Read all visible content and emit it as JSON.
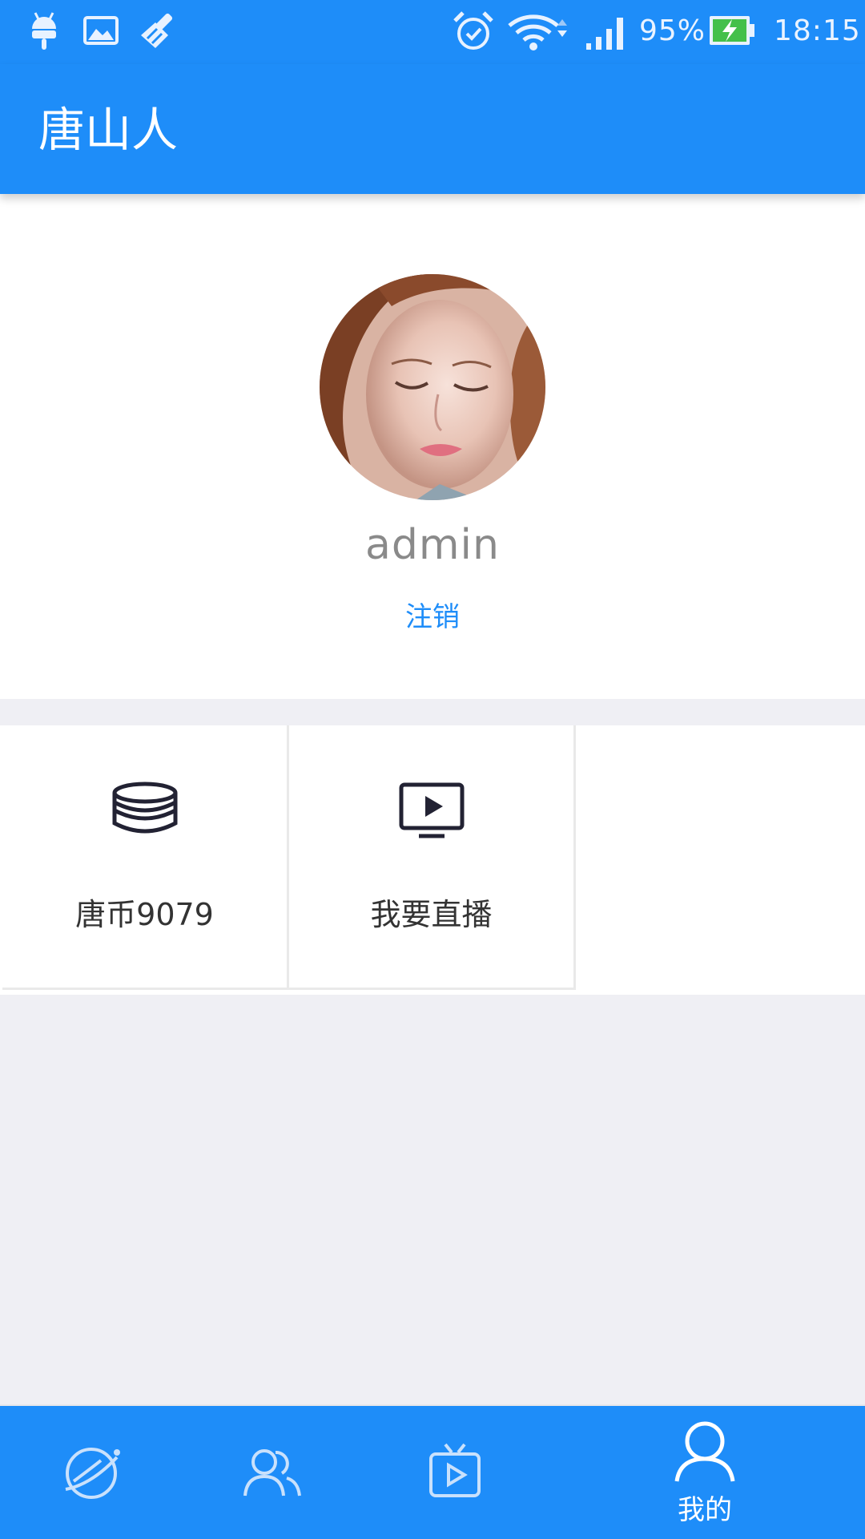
{
  "status_bar": {
    "battery": "95%",
    "time": "18:15",
    "left_icons": [
      "android-debug-icon",
      "image-icon",
      "broom-icon"
    ],
    "right_icons": [
      "alarm-icon",
      "wifi-icon",
      "signal-icon",
      "battery-charging-icon"
    ]
  },
  "app_bar": {
    "title": "唐山人"
  },
  "profile": {
    "username": "admin",
    "logout_label": "注销"
  },
  "grid": {
    "items": [
      {
        "label": "唐币9079",
        "icon": "coins-stack-icon"
      },
      {
        "label": "我要直播",
        "icon": "live-tv-icon"
      }
    ]
  },
  "bottom_nav": {
    "items": [
      {
        "label": "",
        "icon": "planet-icon",
        "selected": false
      },
      {
        "label": "",
        "icon": "contacts-icon",
        "selected": false
      },
      {
        "label": "",
        "icon": "tv-play-icon",
        "selected": false
      },
      {
        "label": "我的",
        "icon": "user-icon",
        "selected": true
      }
    ]
  },
  "colors": {
    "primary": "#1e8df9",
    "background": "#efeff4",
    "username": "#8a8a8a",
    "link": "#1e8df9"
  }
}
